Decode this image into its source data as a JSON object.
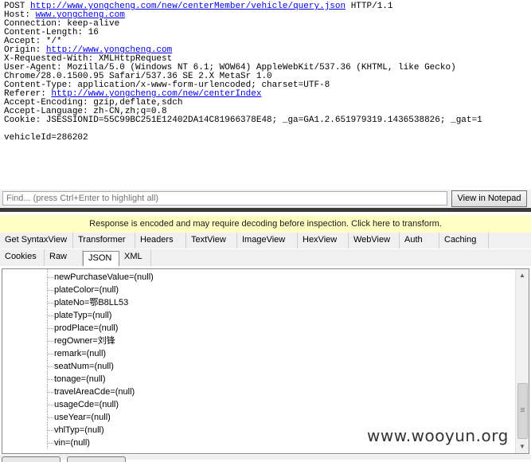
{
  "request": {
    "lines": [
      {
        "parts": [
          {
            "t": "POST "
          },
          {
            "t": "http://www.yongcheng.com/new/centerMember/vehicle/query.json",
            "link": true
          },
          {
            "t": " HTTP/1.1"
          }
        ]
      },
      {
        "parts": [
          {
            "t": "Host: "
          },
          {
            "t": "www.yongcheng.com",
            "link": true
          }
        ]
      },
      {
        "parts": [
          {
            "t": "Connection: keep-alive"
          }
        ]
      },
      {
        "parts": [
          {
            "t": "Content-Length: 16"
          }
        ]
      },
      {
        "parts": [
          {
            "t": "Accept: */*"
          }
        ]
      },
      {
        "parts": [
          {
            "t": "Origin: "
          },
          {
            "t": "http://www.yongcheng.com",
            "link": true
          }
        ]
      },
      {
        "parts": [
          {
            "t": "X-Requested-With: XMLHttpRequest"
          }
        ]
      },
      {
        "parts": [
          {
            "t": "User-Agent: Mozilla/5.0 (Windows NT 6.1; WOW64) AppleWebKit/537.36 (KHTML, like Gecko)"
          }
        ]
      },
      {
        "parts": [
          {
            "t": "Chrome/28.0.1500.95 Safari/537.36 SE 2.X MetaSr 1.0"
          }
        ]
      },
      {
        "parts": [
          {
            "t": "Content-Type: application/x-www-form-urlencoded; charset=UTF-8"
          }
        ]
      },
      {
        "parts": [
          {
            "t": "Referer: "
          },
          {
            "t": "http://www.yongcheng.com/new/centerIndex",
            "link": true
          }
        ]
      },
      {
        "parts": [
          {
            "t": "Accept-Encoding: gzip,deflate,sdch"
          }
        ]
      },
      {
        "parts": [
          {
            "t": "Accept-Language: zh-CN,zh;q=0.8"
          }
        ]
      },
      {
        "parts": [
          {
            "t": "Cookie: JSESSIONID=55C99BC251E12402DA14C81966378E48; _ga=GA1.2.651979319.1436538826; _gat=1"
          }
        ]
      },
      {
        "parts": [
          {
            "t": ""
          }
        ]
      },
      {
        "parts": [
          {
            "t": "vehicleId=286202"
          }
        ]
      }
    ]
  },
  "find_bar": {
    "placeholder": "Find... (press Ctrl+Enter to highlight all)",
    "view_in_notepad": "View in Notepad"
  },
  "warning": "Response is encoded and may require decoding before inspection. Click here to transform.",
  "tabs_row1": [
    "Get SyntaxView",
    "Transformer",
    "Headers",
    "TextView",
    "ImageView",
    "HexView",
    "WebView",
    "Auth",
    "Caching"
  ],
  "tabs_row2": [
    "Cookies",
    "Raw",
    "JSON",
    "XML"
  ],
  "selected_tab": "JSON",
  "tree_items": [
    "newPurchaseValue=(null)",
    "plateColor=(null)",
    "plateNo=鄂B8LL53",
    "plateTyp=(null)",
    "prodPlace=(null)",
    "regOwner=刘锋",
    "remark=(null)",
    "seatNum=(null)",
    "tonage=(null)",
    "travelAreaCde=(null)",
    "usageCde=(null)",
    "useYear=(null)",
    "vhlTyp=(null)",
    "vin=(null)"
  ],
  "watermark": "www.wooyun.org",
  "colors": {
    "link": "#0000ee",
    "warning_bg": "#ffffc4",
    "splitter": "#3a3a3a"
  }
}
